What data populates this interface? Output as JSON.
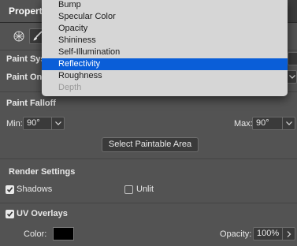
{
  "panel": {
    "title": "Properti",
    "paint_system_label": "Paint Sys",
    "paint_on_label": "Paint On:"
  },
  "paint_falloff": {
    "heading": "Paint Falloff",
    "min_label": "Min:",
    "min_value": "90°",
    "max_label": "Max:",
    "max_value": "90°",
    "select_area_button": "Select Paintable Area"
  },
  "render_settings": {
    "heading": "Render Settings",
    "shadows_label": "Shadows",
    "shadows_checked": true,
    "unlit_label": "Unlit",
    "unlit_checked": false
  },
  "uv_overlays": {
    "label": "UV Overlays",
    "checked": true,
    "color_label": "Color:",
    "color_value": "#000000",
    "opacity_label": "Opacity:",
    "opacity_value": "100%"
  },
  "dropdown_menu": {
    "items": [
      {
        "label": "Bump",
        "state": "normal"
      },
      {
        "label": "Specular Color",
        "state": "normal"
      },
      {
        "label": "Opacity",
        "state": "normal"
      },
      {
        "label": "Shininess",
        "state": "normal"
      },
      {
        "label": "Self-Illumination",
        "state": "normal"
      },
      {
        "label": "Reflectivity",
        "state": "highlighted"
      },
      {
        "label": "Roughness",
        "state": "normal"
      },
      {
        "label": "Depth",
        "state": "disabled"
      }
    ]
  },
  "colors": {
    "panel_bg": "#535353",
    "menu_bg": "#d6d6d6",
    "highlight": "#0a5ed8"
  }
}
